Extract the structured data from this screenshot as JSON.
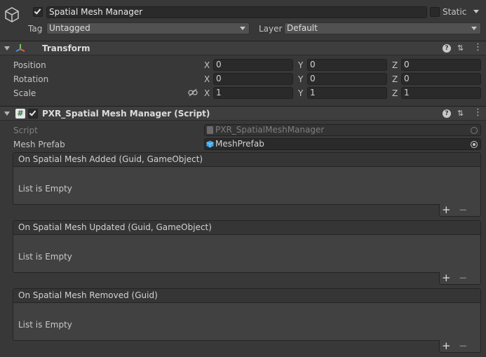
{
  "object": {
    "name": "Spatial Mesh Manager",
    "static_label": "Static",
    "tag_label": "Tag",
    "tag_value": "Untagged",
    "layer_label": "Layer",
    "layer_value": "Default"
  },
  "transform": {
    "title": "Transform",
    "rows": [
      {
        "label": "Position",
        "x": "0",
        "y": "0",
        "z": "0"
      },
      {
        "label": "Rotation",
        "x": "0",
        "y": "0",
        "z": "0"
      },
      {
        "label": "Scale",
        "x": "1",
        "y": "1",
        "z": "1"
      }
    ],
    "axis": {
      "x": "X",
      "y": "Y",
      "z": "Z"
    }
  },
  "script_component": {
    "title": "PXR_Spatial Mesh Manager (Script)",
    "script_label": "Script",
    "script_value": "PXR_SpatialMeshManager",
    "prefab_label": "Mesh Prefab",
    "prefab_value": "MeshPrefab",
    "events": [
      {
        "title": "On Spatial Mesh Added (Guid, GameObject)",
        "empty": "List is Empty"
      },
      {
        "title": "On Spatial Mesh Updated (Guid, GameObject)",
        "empty": "List is Empty"
      },
      {
        "title": "On Spatial Mesh Removed (Guid)",
        "empty": "List is Empty"
      }
    ],
    "add_glyph": "+",
    "remove_glyph": "−"
  },
  "icons": {
    "help": "?",
    "settings": "⇅",
    "menu": "⋮"
  }
}
